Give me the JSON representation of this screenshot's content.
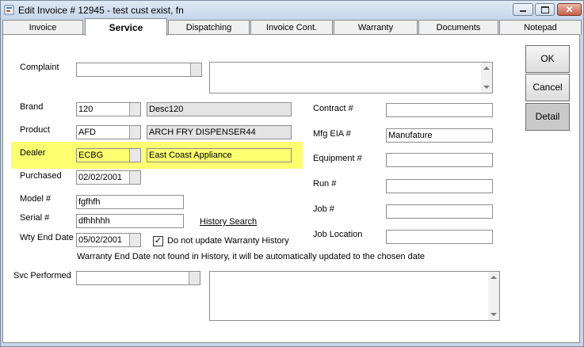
{
  "window": {
    "title": "Edit Invoice # 12945  -  test cust exist, fn"
  },
  "tabs": [
    "Invoice",
    "Service",
    "Dispatching",
    "Invoice Cont.",
    "Warranty",
    "Documents",
    "Notepad"
  ],
  "labels": {
    "complaint": "Complaint",
    "brand": "Brand",
    "product": "Product",
    "dealer": "Dealer",
    "purchased": "Purchased",
    "model": "Model #",
    "serial": "Serial #",
    "wty_end_date": "Wty End Date",
    "svc_performed": "Svc Performed",
    "contract": "Contract #",
    "mfg_eia": "Mfg EIA #",
    "equipment": "Equipment #",
    "run": "Run #",
    "job": "Job #",
    "job_location": "Job Location"
  },
  "fields": {
    "brand_code": "120",
    "brand_desc": "Desc120",
    "product_code": "AFD",
    "product_desc": "ARCH FRY DISPENSER44",
    "dealer_code": "ECBG",
    "dealer_name": "East Coast Appliance",
    "purchased": "02/02/2001",
    "model": "fgfhfh",
    "serial": "dfhhhhh",
    "wty_end_date": "05/02/2001",
    "mfg_eia": "Manufature",
    "contract": "",
    "equipment": "",
    "run": "",
    "job": "",
    "job_location": ""
  },
  "history_search": "History Search",
  "checkbox": {
    "label": "Do not update Warranty History",
    "checked": "✓"
  },
  "warning": "Warranty End Date not found in History, it will be automatically updated to the chosen date",
  "buttons": {
    "ok": "OK",
    "cancel": "Cancel",
    "detail": "Detail"
  },
  "colors": {
    "highlight": "#fbff70",
    "window_frame": "#c8d7e9"
  }
}
